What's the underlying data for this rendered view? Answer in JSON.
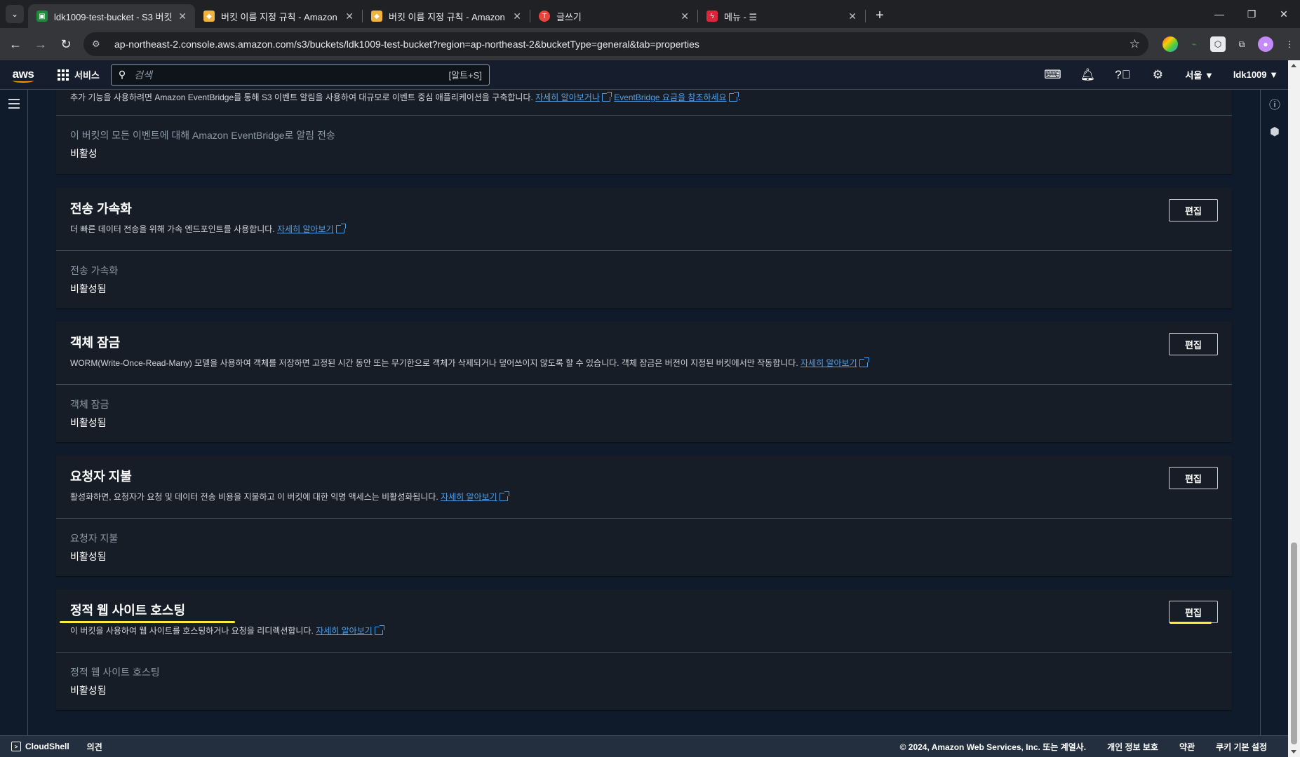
{
  "browser": {
    "tabs": [
      {
        "title": "ldk1009-test-bucket - S3 버킷",
        "icon_color": "#1f8a3b",
        "active": true
      },
      {
        "title": "버킷 이름 지정 규칙 - Amazon",
        "icon_color": "#f0b43c",
        "active": false
      },
      {
        "title": "버킷 이름 지정 규칙 - Amazon",
        "icon_color": "#f0b43c",
        "active": false
      },
      {
        "title": "글쓰기",
        "icon_color": "#e8453c",
        "active": false
      },
      {
        "title": "메뉴 - ☰",
        "icon_color": "#e0243c",
        "active": false
      }
    ],
    "url": "ap-northeast-2.console.aws.amazon.com/s3/buckets/ldk1009-test-bucket?region=ap-northeast-2&bucketType=general&tab=properties"
  },
  "awsnav": {
    "logo": "aws",
    "services_label": "서비스",
    "search_placeholder": "검색",
    "search_shortcut": "[알트+S]",
    "region": "서울 ▼",
    "account": "ldk1009 ▼"
  },
  "panels": {
    "eventbridge": {
      "desc_prefix": "추가 기능을 사용하려면 Amazon EventBridge를 통해 S3 이벤트 알림을 사용하여 대규모로 이벤트 중심 애플리케이션을 구축합니다.",
      "link1": "자세히 알아보거나",
      "link2": "EventBridge 요금을 참조하세요",
      "desc_suffix": ".",
      "label": "이 버킷의 모든 이벤트에 대해 Amazon EventBridge로 알림 전송",
      "value": "비활성"
    },
    "acceleration": {
      "title": "전송 가속화",
      "desc": "더 빠른 데이터 전송을 위해 가속 엔드포인트를 사용합니다.",
      "link": "자세히 알아보기",
      "edit": "편집",
      "label": "전송 가속화",
      "value": "비활성됨"
    },
    "objectlock": {
      "title": "객체 잠금",
      "desc": "WORM(Write-Once-Read-Many) 모델을 사용하여 객체를 저장하면 고정된 시간 동안 또는 무기한으로 객체가 삭제되거나 덮어쓰이지 않도록 할 수 있습니다. 객체 잠금은 버전이 지정된 버킷에서만 작동합니다.",
      "link": "자세히 알아보기",
      "edit": "편집",
      "label": "객체 잠금",
      "value": "비활성됨"
    },
    "requester": {
      "title": "요청자 지불",
      "desc": "활성화하면, 요청자가 요청 및 데이터 전송 비용을 지불하고 이 버킷에 대한 익명 액세스는 비활성화됩니다.",
      "link": "자세히 알아보기",
      "edit": "편집",
      "label": "요청자 지불",
      "value": "비활성됨"
    },
    "website": {
      "title": "정적 웹 사이트 호스팅",
      "desc": "이 버킷을 사용하여 웹 사이트를 호스팅하거나 요청을 리디렉션합니다.",
      "link": "자세히 알아보기",
      "edit": "편집",
      "label": "정적 웹 사이트 호스팅",
      "value": "비활성됨"
    }
  },
  "footer": {
    "cloudshell": "CloudShell",
    "feedback": "의견",
    "copyright": "© 2024, Amazon Web Services, Inc. 또는 계열사.",
    "privacy": "개인 정보 보호",
    "terms": "약관",
    "cookies": "쿠키 기본 설정"
  },
  "colors": {
    "highlight": "#ffeb3b",
    "link": "#539fe5"
  }
}
